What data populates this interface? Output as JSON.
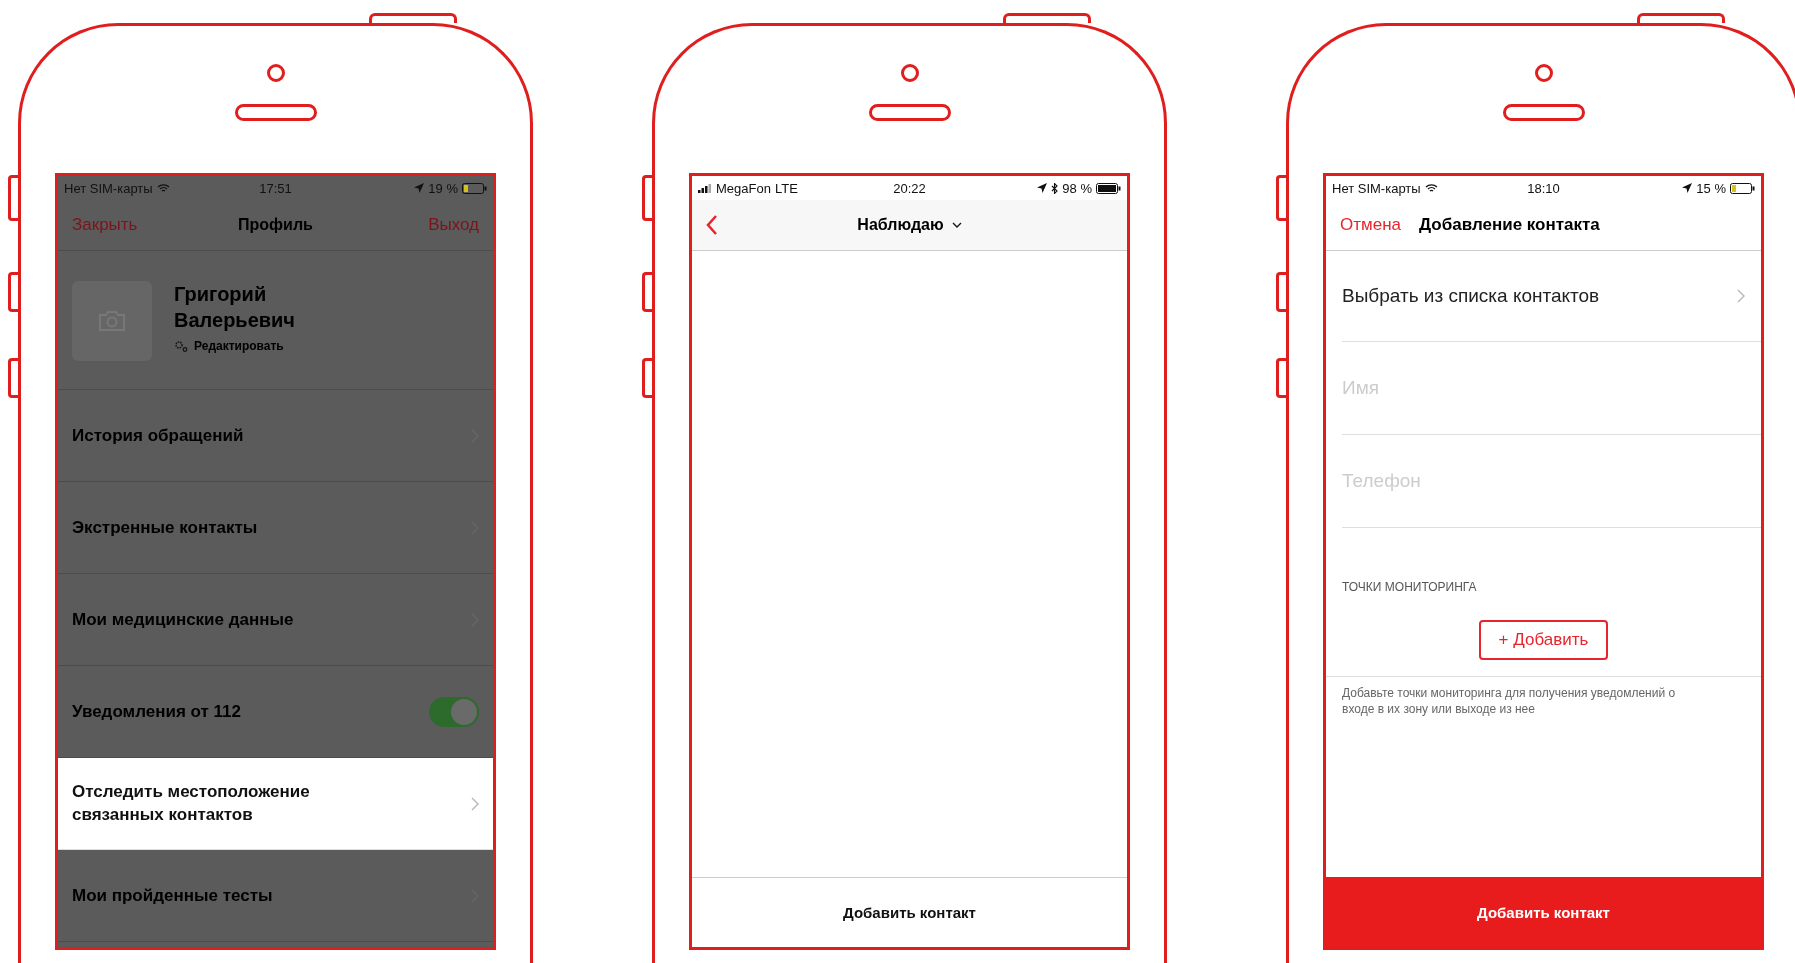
{
  "profile_screen": {
    "dimmed": true,
    "status_bar": {
      "carrier": "Нет SIM-карты",
      "time": "17:51",
      "battery": "19 %"
    },
    "nav": {
      "left": "Закрыть",
      "title": "Профиль",
      "right": "Выход"
    },
    "profile": {
      "first_name": "Григорий",
      "last_name": "Валерьевич",
      "edit": "Редактировать"
    },
    "items": [
      {
        "kind": "link",
        "label": "История обращений",
        "highlighted": false
      },
      {
        "kind": "link",
        "label": "Экстренные контакты",
        "highlighted": false
      },
      {
        "kind": "link",
        "label": "Мои медицинские данные",
        "highlighted": false
      },
      {
        "kind": "toggle",
        "label": "Уведомления от 112",
        "on": true,
        "highlighted": false
      },
      {
        "kind": "link",
        "label": "Отследить местоположение связанных контактов",
        "highlighted": true
      },
      {
        "kind": "link",
        "label": "Мои пройденные тесты",
        "highlighted": false
      }
    ]
  },
  "watching_screen": {
    "status_bar": {
      "carrier": "MegaFon",
      "network": "LTE",
      "time": "20:22",
      "battery": "98 %"
    },
    "nav": {
      "title": "Наблюдаю"
    },
    "bottom_button": "Добавить контакт"
  },
  "add_contact_screen": {
    "status_bar": {
      "carrier": "Нет SIM-карты",
      "time": "18:10",
      "battery": "15 %"
    },
    "nav": {
      "left": "Отмена",
      "title": "Добавление контакта"
    },
    "pick_contact": "Выбрать из списка контактов",
    "fields": [
      {
        "placeholder": "Имя"
      },
      {
        "placeholder": "Телефон"
      }
    ],
    "section_label": "ТОЧКИ МОНИТОРИНГА",
    "add_button": "+ Добавить",
    "hint": "Добавьте точки мониторинга для получения уведомлений о входе в их зону или выходе из нее",
    "bottom_button": "Добавить контакт"
  }
}
